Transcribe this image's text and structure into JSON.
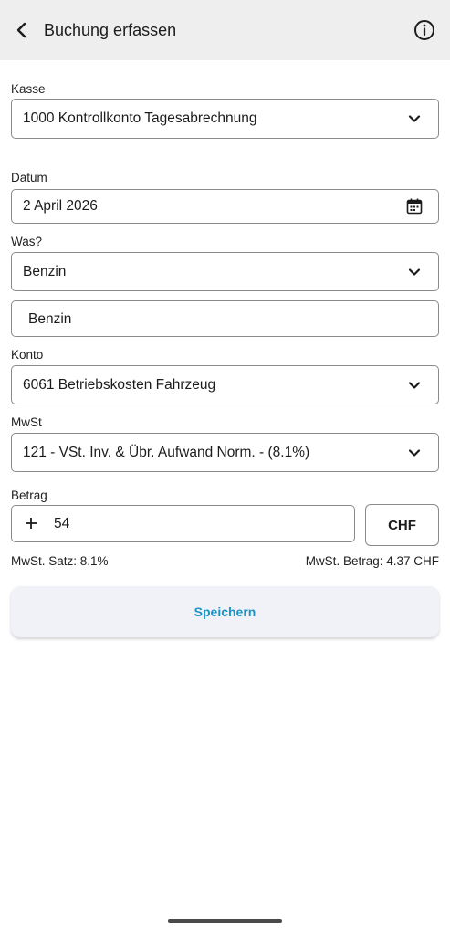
{
  "header": {
    "title": "Buchung erfassen",
    "back_icon": "chevron-left-icon",
    "info_icon": "info-circle-icon"
  },
  "form": {
    "kasse": {
      "label": "Kasse",
      "value": "1000 Kontrollkonto Tagesabrechnung"
    },
    "datum": {
      "label": "Datum",
      "value": "2 April 2026"
    },
    "was": {
      "label": "Was?",
      "value": "Benzin",
      "description": "Benzin"
    },
    "konto": {
      "label": "Konto",
      "value": "6061 Betriebskosten Fahrzeug"
    },
    "mwst": {
      "label": "MwSt",
      "value": "121 - VSt. Inv. & Übr. Aufwand Norm. - (8.1%)"
    },
    "betrag": {
      "label": "Betrag",
      "sign": "+",
      "value": "54",
      "currency": "CHF"
    },
    "mwst_satz": "MwSt. Satz: 8.1%",
    "mwst_betrag": "MwSt. Betrag: 4.37 CHF"
  },
  "actions": {
    "save_label": "Speichern"
  },
  "colors": {
    "appbar_bg": "#eeeeee",
    "accent": "#1b94c4",
    "button_bg": "#f1f2f7"
  }
}
